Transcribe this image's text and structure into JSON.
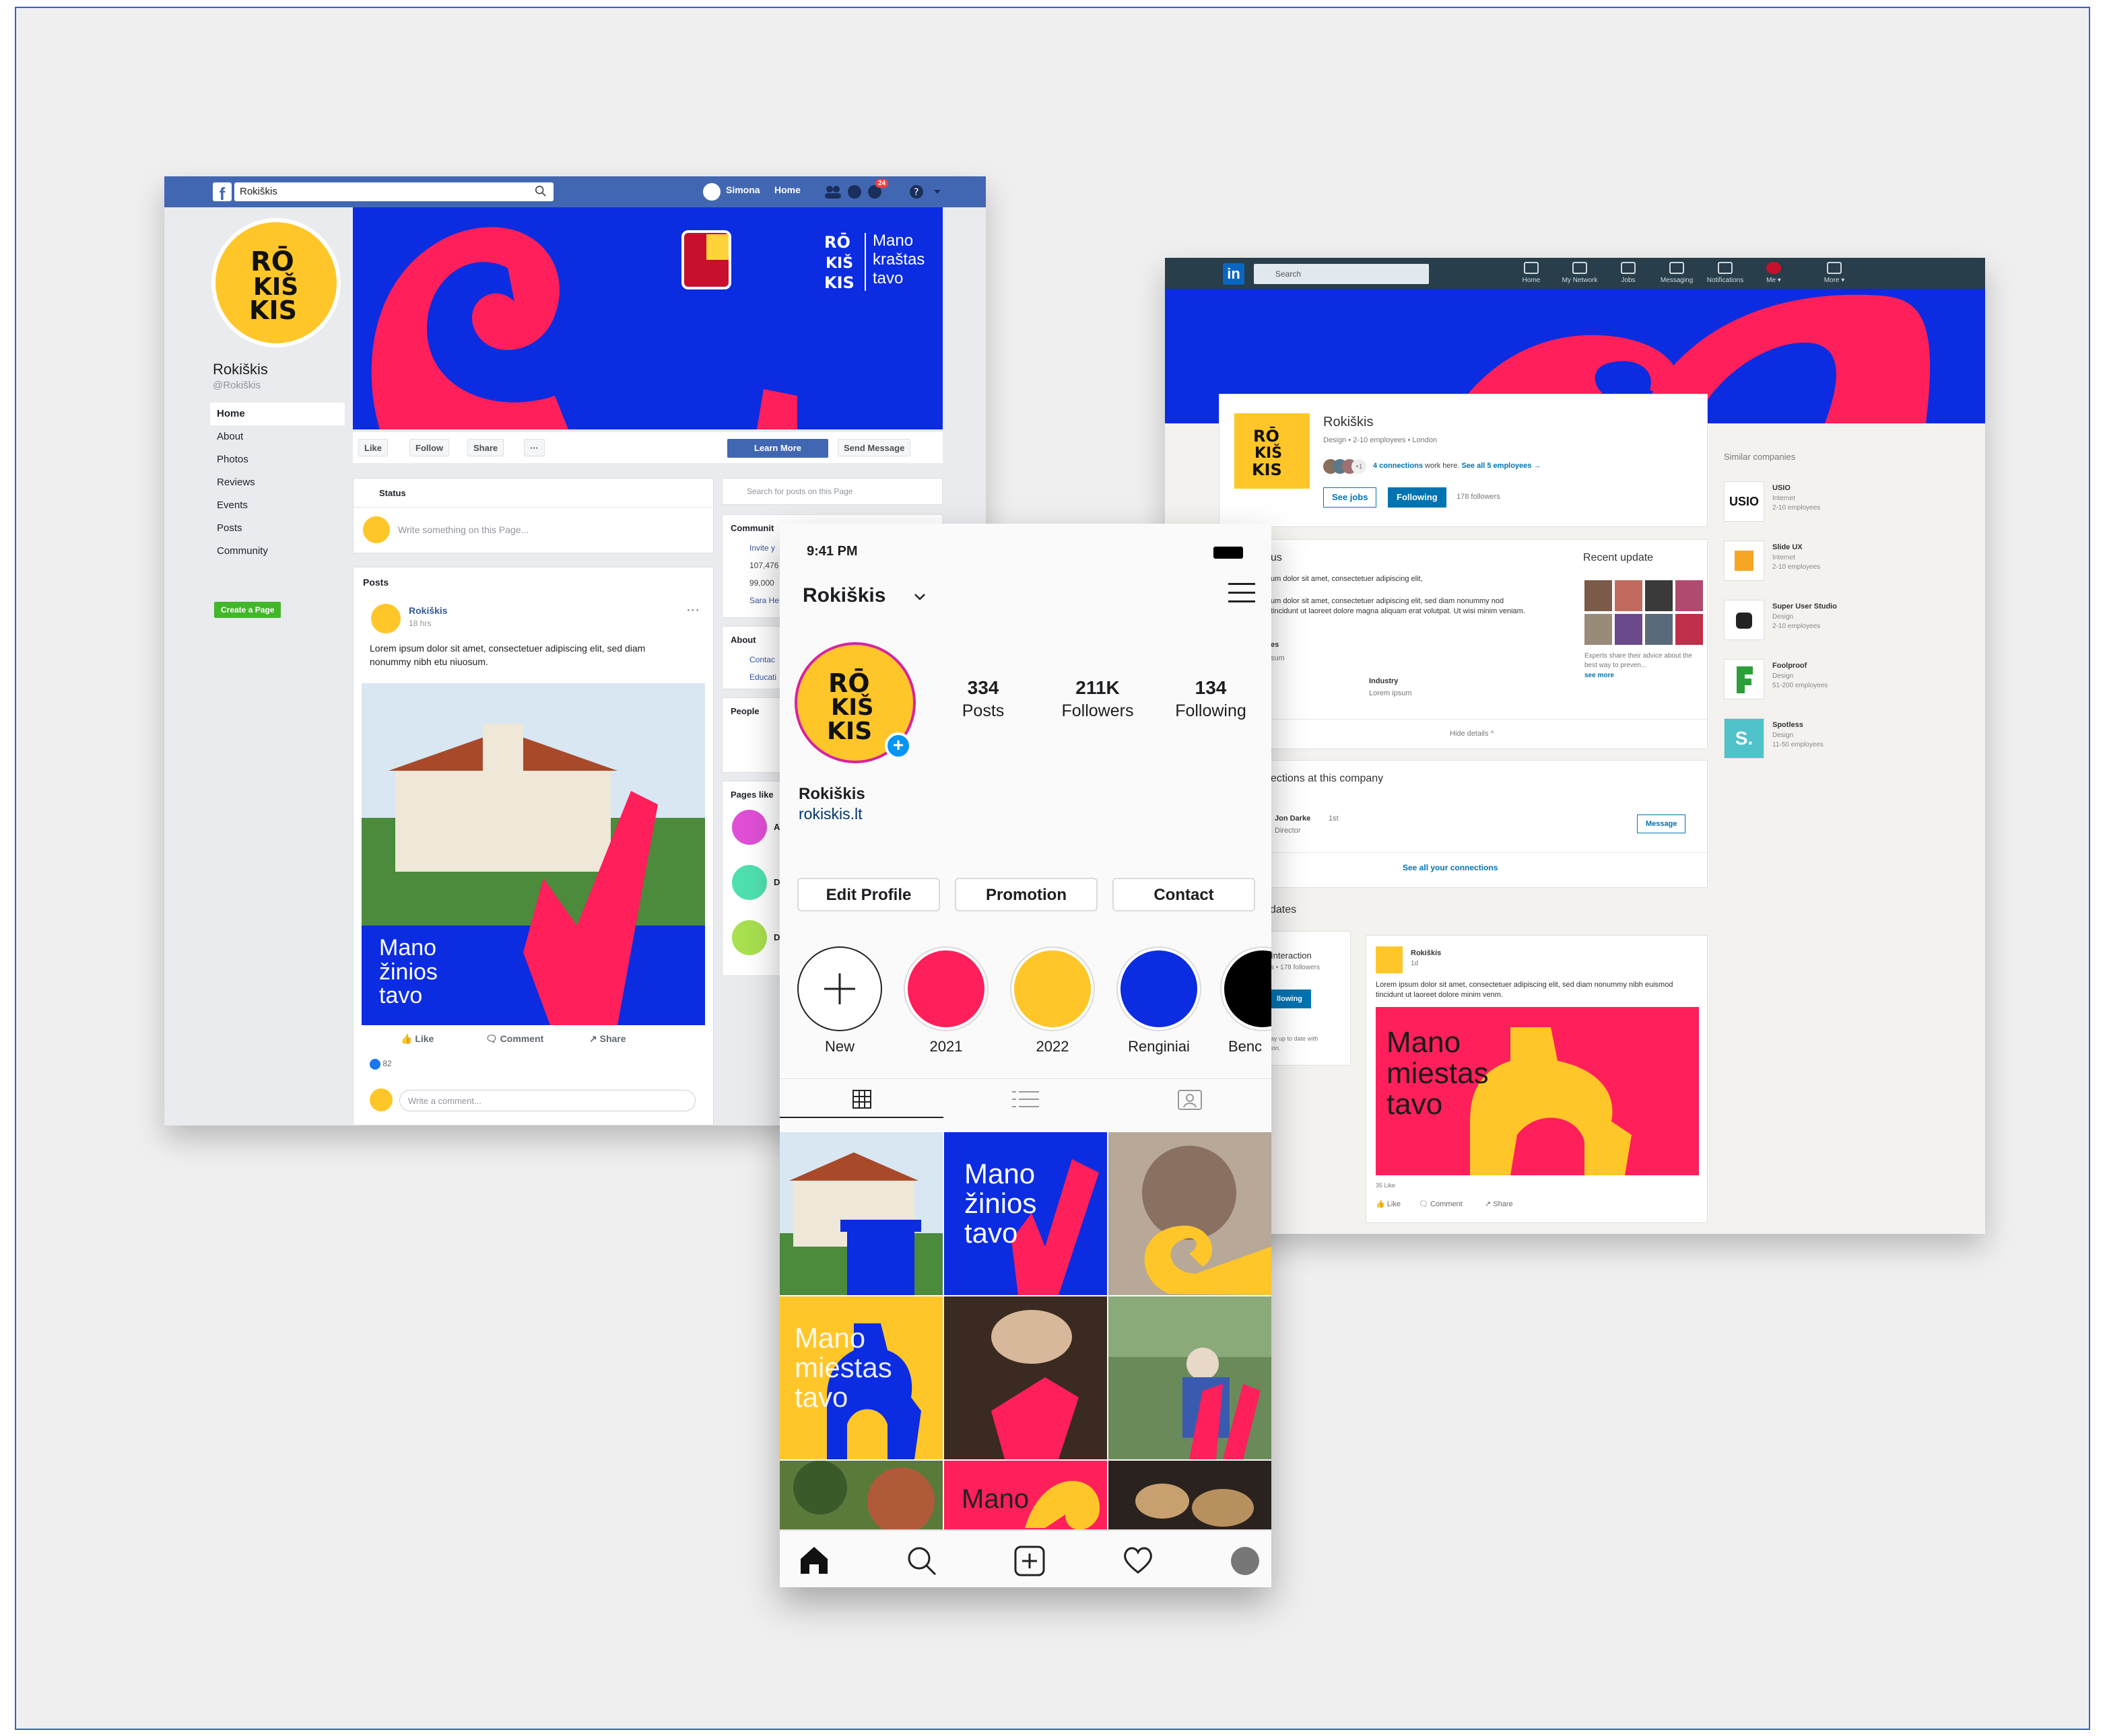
{
  "facebook": {
    "search_value": "Rokiškis",
    "logo_letter": "f",
    "nav": {
      "user": "Simona",
      "home": "Home",
      "badge": "24"
    },
    "page_name": "Rokiškis",
    "handle": "@Rokiškis",
    "menu": [
      "Home",
      "About",
      "Photos",
      "Reviews",
      "Events",
      "Posts",
      "Community"
    ],
    "create_page": "Create a Page",
    "cover_text": [
      "Mano",
      "kraštas",
      "tavo"
    ],
    "actions": {
      "like": "Like",
      "follow": "Follow",
      "share": "Share",
      "more": "···",
      "learn_more": "Learn More",
      "send_message": "Send Message"
    },
    "status": {
      "label": "Status",
      "placeholder": "Write something on this Page..."
    },
    "search_posts_placeholder": "Search for posts on this Page",
    "community": {
      "title": "Communit",
      "rows": [
        "Invite y",
        "107,476",
        "99,000",
        "Sara He"
      ]
    },
    "about": {
      "title": "About",
      "rows": [
        "Contac",
        "Educati"
      ]
    },
    "people_title": "People",
    "pages_liked_title": "Pages like",
    "pages_liked_colors": [
      "#e04fd6",
      "#4fe0b0",
      "#a8e04f"
    ],
    "pages_liked_initials": [
      "A",
      "D",
      "D"
    ],
    "posts_title": "Posts",
    "post": {
      "author": "Rokiškis",
      "time": "18 hrs",
      "text": "Lorem ipsum dolor sit amet, consectetuer adipiscing elit, sed diam nonummy nibh  etu niuosum.",
      "image_text": [
        "Mano",
        "žinios",
        "tavo"
      ],
      "like": "Like",
      "comment": "Comment",
      "share": "Share",
      "reactions": "82",
      "comment_placeholder": "Write a comment..."
    }
  },
  "linkedin": {
    "logo": "in",
    "search_placeholder": "Search",
    "nav": [
      "Home",
      "My Network",
      "Jobs",
      "Messaging",
      "Notifications",
      "Me ▾",
      "More ▾"
    ],
    "company": "Rokiškis",
    "meta": "Design • 2-10 employees • London",
    "connections_link": "4 connections",
    "connections_text": "work here.",
    "see_all_employees": "See all 5 employees →",
    "avatar_extra": "+1",
    "see_jobs": "See jobs",
    "following": "Following",
    "followers": "178 followers",
    "about": {
      "title": "us",
      "p1": "um dolor sit amet, consectetuer adipiscing elit,",
      "p2": "um dolor sit amet, consectetuer adipiscing elit, sed diam nonummy nod tincidunt ut laoreet dolore magna aliquam erat volutpat. Ut wisi minim veniam.",
      "k1": "es",
      "v1": "sum",
      "industry_label": "Industry",
      "industry_value": "Lorem ipsum",
      "hide": "Hide details ^"
    },
    "recent_update": {
      "title": "Recent update",
      "caption": "Experts share their advice about the best way to preven...",
      "more": "see more"
    },
    "connections_card": {
      "title": "ections at this company",
      "name": "Jon Darke",
      "degree": "1st",
      "role": "Director",
      "message": "Message",
      "see_all": "See all your connections"
    },
    "updates_title": "dates",
    "interaction": {
      "title": "Interaction",
      "sub": "s • 178 followers",
      "btn": "llowing",
      "text": "ay up to date with",
      "text2": "ion."
    },
    "feed_post": {
      "author": "Rokiškis",
      "time": "1d",
      "text": "Lorem ipsum dolor sit amet, consectetuer adipiscing elit, sed diam nonummy nibh euismod tincidunt ut laoreet dolore minim venm.",
      "image_text": [
        "Mano",
        "miestas",
        "tavo"
      ],
      "likes": "35 Like",
      "like": "Like",
      "comment": "Comment",
      "share": "Share"
    },
    "similar_title": "Similar companies",
    "similar": [
      {
        "name": "USIO",
        "cat": "Internet",
        "size": "2-10 employees",
        "logo": "USIO"
      },
      {
        "name": "Slide UX",
        "cat": "Internet",
        "size": "2-10 employees",
        "logo": ""
      },
      {
        "name": "Super User Studio",
        "cat": "Design",
        "size": "2-10 employees",
        "logo": ""
      },
      {
        "name": "Foolproof",
        "cat": "Design",
        "size": "51-200 employees",
        "logo": ""
      },
      {
        "name": "Spotless",
        "cat": "Design",
        "size": "11-50 employees",
        "logo": "S."
      }
    ]
  },
  "instagram": {
    "time": "9:41 PM",
    "username": "Rokiškis",
    "stats": [
      {
        "value": "334",
        "label": "Posts"
      },
      {
        "value": "211K",
        "label": "Followers"
      },
      {
        "value": "134",
        "label": "Following"
      }
    ],
    "name": "Rokiškis",
    "link": "rokiskis.lt",
    "buttons": [
      "Edit Profile",
      "Promotion",
      "Contact"
    ],
    "stories": [
      {
        "label": "New",
        "color": "#ffffff"
      },
      {
        "label": "2021",
        "color": "#ff1f5a"
      },
      {
        "label": "2022",
        "color": "#ffc629"
      },
      {
        "label": "Renginiai",
        "color": "#0b2ce0"
      },
      {
        "label": "Benc",
        "color": "#000000"
      }
    ],
    "tiles_text": {
      "t2": [
        "Mano",
        "žinios",
        "tavo"
      ],
      "t4": [
        "Mano",
        "miestas",
        "tavo"
      ],
      "t8": [
        "Mano"
      ]
    }
  },
  "brand_colors": {
    "blue": "#0b2ce0",
    "pink": "#ff1f5a",
    "yellow": "#ffc629"
  },
  "logo_lettering": "RŌ KIŠ KIS"
}
